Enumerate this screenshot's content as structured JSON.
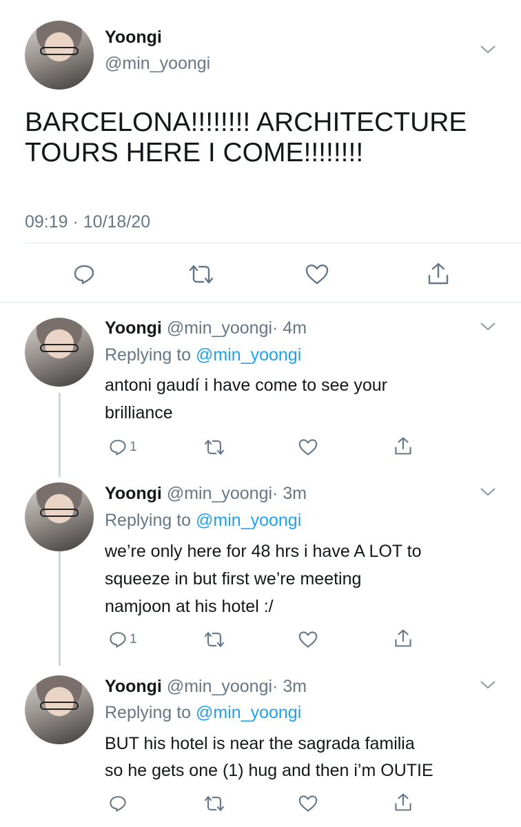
{
  "main_tweet": {
    "name": "Yoongi",
    "handle": "@min_yoongi",
    "text_line1": "BARCELONA!!!!!!!! ARCHITECTURE",
    "text_line2": "TOURS HERE I COME!!!!!!!!",
    "timestamp": "09:19 · 10/18/20",
    "actions": [
      "reply-icon",
      "retweet-icon",
      "like-icon",
      "share-icon"
    ]
  },
  "replies": [
    {
      "name": "Yoongi",
      "handle": "@min_yoongi",
      "time": "· 4m",
      "replying_prefix": "Replying to",
      "replying_to": "@min_yoongi",
      "lines": [
        "antoni gaudí i have come to see your",
        "brilliance"
      ],
      "reply_count": "1"
    },
    {
      "name": "Yoongi",
      "handle": "@min_yoongi",
      "time": "· 3m",
      "replying_prefix": "Replying to",
      "replying_to": "@min_yoongi",
      "lines": [
        "we’re only here for 48 hrs i have A LOT to",
        "squeeze in but first we’re meeting",
        "namjoon at his hotel :/"
      ],
      "reply_count": "1"
    },
    {
      "name": "Yoongi",
      "handle": "@min_yoongi",
      "time": "· 3m",
      "replying_prefix": "Replying to",
      "replying_to": "@min_yoongi",
      "lines": [
        "BUT his hotel is near the sagrada familia",
        "so he gets one (1) hug and then i’m OUTIE"
      ],
      "reply_count": ""
    }
  ],
  "colors": {
    "link": "#1da1f2",
    "muted": "#657786",
    "text": "#14171a",
    "divider": "#e1e8ed"
  }
}
